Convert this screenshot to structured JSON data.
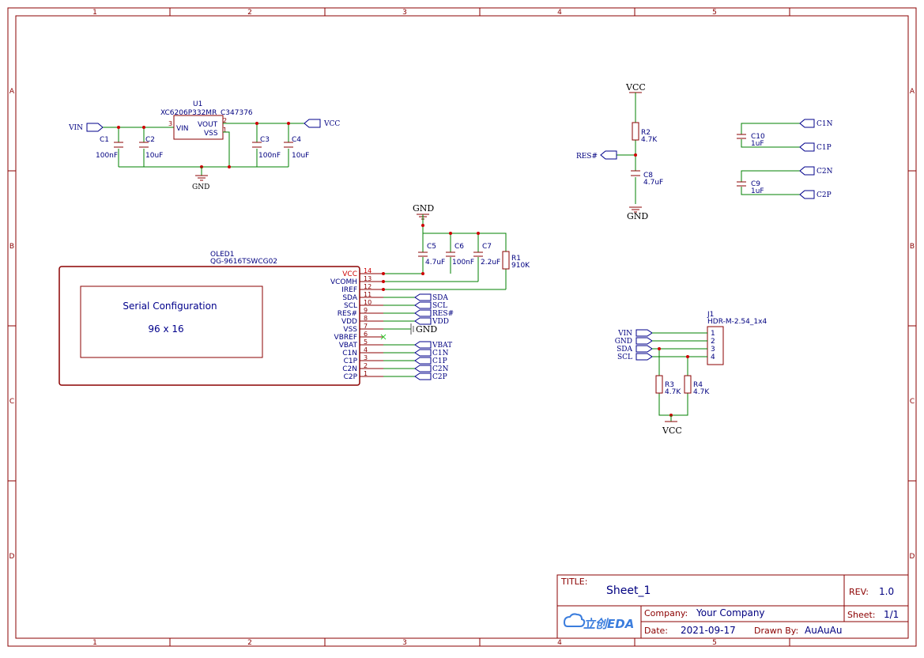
{
  "zones": {
    "cols": [
      "1",
      "2",
      "3",
      "4",
      "5"
    ],
    "rows": [
      "A",
      "B",
      "C",
      "D"
    ]
  },
  "regulator": {
    "ref": "U1",
    "part": "XC6206P332MR",
    "lcsc": "C347376",
    "pin_vin": "VIN",
    "pin_vout": "VOUT",
    "pin_vss": "VSS",
    "pin3": "3",
    "pin2": "2",
    "pin1": "1",
    "input_net": "VIN",
    "output_net": "VCC",
    "gnd": "GND",
    "caps": [
      {
        "ref": "C1",
        "value": "100nF"
      },
      {
        "ref": "C2",
        "value": "10uF"
      },
      {
        "ref": "C3",
        "value": "100nF"
      },
      {
        "ref": "C4",
        "value": "10uF"
      }
    ]
  },
  "oled": {
    "ref": "OLED1",
    "part": "QG-9616TSWCG02",
    "line1": "Serial Configuration",
    "line2": "96 x 16",
    "pins": [
      {
        "name": "VCC",
        "num": "14"
      },
      {
        "name": "VCOMH",
        "num": "13"
      },
      {
        "name": "IREF",
        "num": "12"
      },
      {
        "name": "SDA",
        "num": "11"
      },
      {
        "name": "SCL",
        "num": "10"
      },
      {
        "name": "RES#",
        "num": "9"
      },
      {
        "name": "VDD",
        "num": "8"
      },
      {
        "name": "VSS",
        "num": "7"
      },
      {
        "name": "VBREF",
        "num": "6"
      },
      {
        "name": "VBAT",
        "num": "5"
      },
      {
        "name": "C1N",
        "num": "4"
      },
      {
        "name": "C1P",
        "num": "3"
      },
      {
        "name": "C2N",
        "num": "2"
      },
      {
        "name": "C2P",
        "num": "1"
      }
    ],
    "nets": [
      "SDA",
      "SCL",
      "RES#",
      "VDD",
      "GND",
      "VBAT",
      "C1N",
      "C1P",
      "C2N",
      "C2P"
    ],
    "top_gnd": "GND",
    "caps": [
      {
        "ref": "C5",
        "value": "4.7uF"
      },
      {
        "ref": "C6",
        "value": "100nF"
      },
      {
        "ref": "C7",
        "value": "2.2uF"
      }
    ],
    "res": {
      "ref": "R1",
      "value": "910K"
    }
  },
  "reset": {
    "vcc": "VCC",
    "net": "RES#",
    "gnd": "GND",
    "res": {
      "ref": "R2",
      "value": "4.7K"
    },
    "cap": {
      "ref": "C8",
      "value": "4.7uF"
    }
  },
  "pump": [
    {
      "ref": "C10",
      "value": "1uF",
      "neg": "C1N",
      "pos": "C1P"
    },
    {
      "ref": "C9",
      "value": "1uF",
      "neg": "C2N",
      "pos": "C2P"
    }
  ],
  "header": {
    "ref": "J1",
    "part": "HDR-M-2.54_1x4",
    "nets": [
      "VIN",
      "GND",
      "SDA",
      "SCL"
    ],
    "pins": [
      "1",
      "2",
      "3",
      "4"
    ],
    "vcc": "VCC",
    "r3": {
      "ref": "R3",
      "value": "4.7K"
    },
    "r4": {
      "ref": "R4",
      "value": "4.7K"
    }
  },
  "titleblock": {
    "title_label": "TITLE:",
    "title": "Sheet_1",
    "rev_label": "REV:",
    "rev": "1.0",
    "company_label": "Company:",
    "company": "Your Company",
    "sheet_label": "Sheet:",
    "sheet": "1/1",
    "date_label": "Date:",
    "date": "2021-09-17",
    "drawn_label": "Drawn By:",
    "drawn": "AuAuAu",
    "logo": "立创EDA"
  }
}
